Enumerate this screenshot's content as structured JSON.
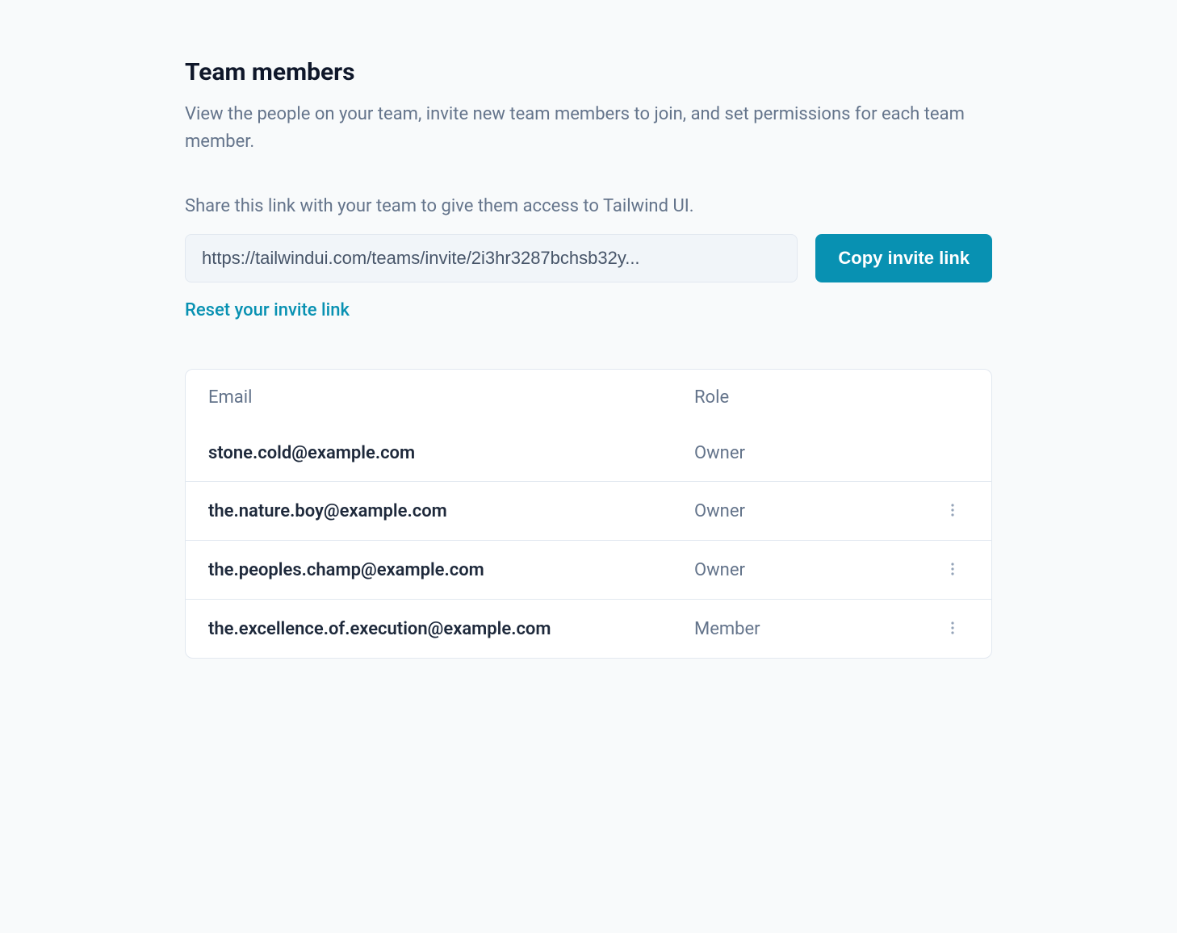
{
  "header": {
    "title": "Team members",
    "description": "View the people on your team, invite new team members to join, and set permissions for each team member."
  },
  "invite": {
    "share_text": "Share this link with your team to give them access to Tailwind UI.",
    "link": "https://tailwindui.com/teams/invite/2i3hr3287bchsb32y...",
    "copy_button": "Copy invite link",
    "reset_link": "Reset your invite link"
  },
  "table": {
    "headers": {
      "email": "Email",
      "role": "Role"
    },
    "rows": [
      {
        "email": "stone.cold@example.com",
        "role": "Owner",
        "has_actions": false
      },
      {
        "email": "the.nature.boy@example.com",
        "role": "Owner",
        "has_actions": true
      },
      {
        "email": "the.peoples.champ@example.com",
        "role": "Owner",
        "has_actions": true
      },
      {
        "email": "the.excellence.of.execution@example.com",
        "role": "Member",
        "has_actions": true
      }
    ]
  }
}
